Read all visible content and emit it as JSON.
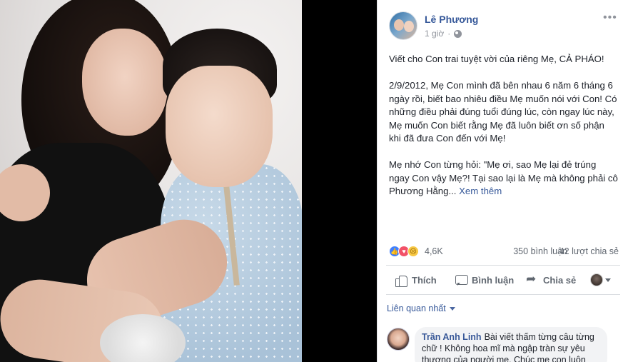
{
  "post": {
    "author": "Lê Phương",
    "time": "1 giờ",
    "paragraphs": [
      "Viết cho Con trai tuyệt vời của riêng Mẹ, CẢ PHÁO!",
      "2/9/2012, Mẹ Con mình đã bên nhau 6 năm 6 tháng 6 ngày rồi, biết bao nhiêu điều Mẹ muốn nói với Con! Có những điều phải đúng tuổi đúng lúc, còn ngay lúc này, Mẹ muốn Con biết rằng Mẹ đã luôn biết ơn số phận khi đã đưa Con đến với Mẹ!",
      "Mẹ nhớ Con từng hỏi: \"Mẹ ơi, sao Mẹ lại đẻ trúng ngay Con vậy Mẹ?! Tại sao lại là Mẹ mà không phải cô Phương Hằng..."
    ],
    "see_more": "Xem thêm",
    "reactions": {
      "icons": [
        "like-icon",
        "love-icon",
        "sad-icon"
      ],
      "count": "4,6K",
      "comments": "350 bình luận",
      "shares": "42 lượt chia sẻ"
    },
    "actions": {
      "like": "Thích",
      "comment": "Bình luận",
      "share": "Chia sẻ"
    },
    "sort_label": "Liên quan nhất"
  },
  "comment": {
    "name": "Trần Anh Linh",
    "text": "Bài viết thấm từng câu từng chữ ! Không hoa mĩ mà ngập tràn sự yêu thương của người mẹ. Chúc mẹ con luôn hạnh phúc nhé"
  },
  "colors": {
    "link": "#365899",
    "text": "#1d2129",
    "muted": "#606770",
    "like_blue": "#4080ff",
    "love_red": "#f25268",
    "sad_yellow": "#f7c844"
  }
}
